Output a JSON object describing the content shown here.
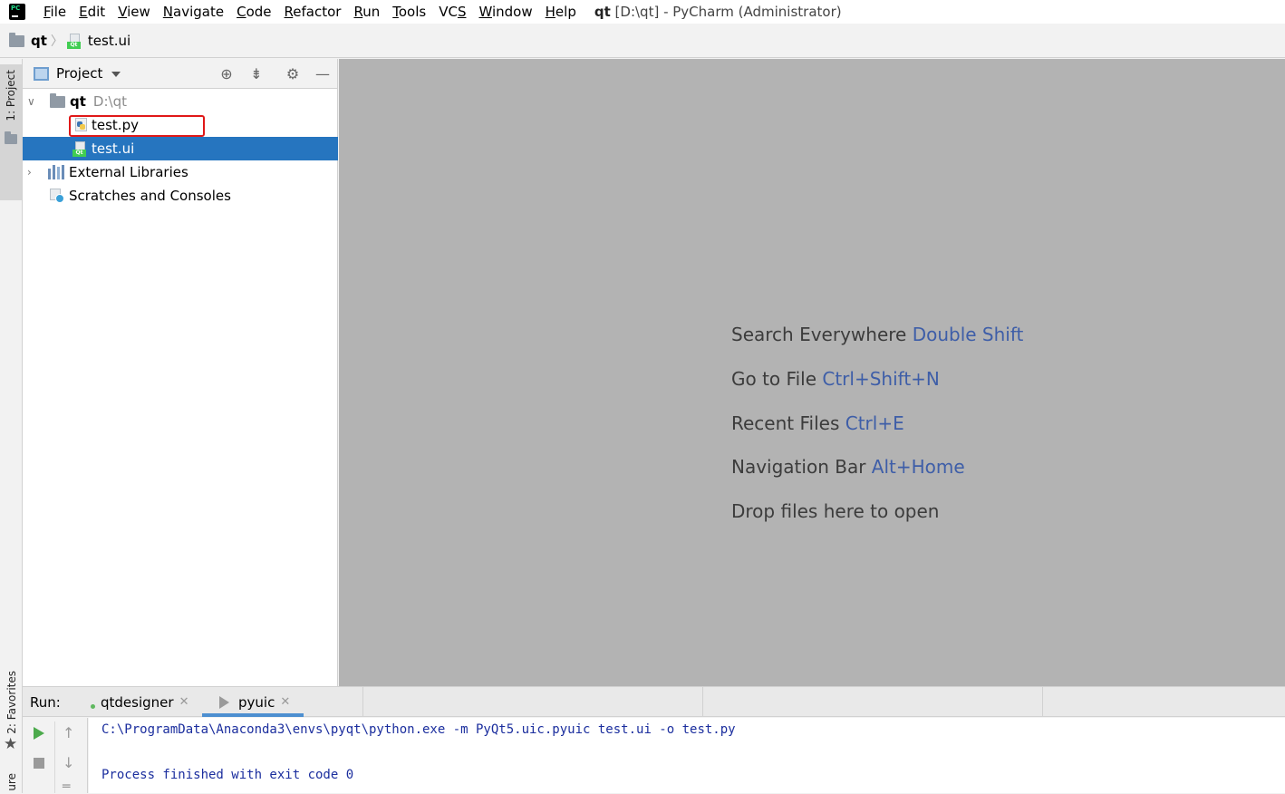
{
  "menubar": {
    "items": [
      {
        "label": "File",
        "mnemonic": "F",
        "rest": "ile"
      },
      {
        "label": "Edit",
        "mnemonic": "E",
        "rest": "dit"
      },
      {
        "label": "View",
        "mnemonic": "V",
        "rest": "iew"
      },
      {
        "label": "Navigate",
        "mnemonic": "N",
        "rest": "avigate"
      },
      {
        "label": "Code",
        "mnemonic": "C",
        "rest": "ode"
      },
      {
        "label": "Refactor",
        "mnemonic": "R",
        "rest": "efactor"
      },
      {
        "label": "Run",
        "mnemonic": "R",
        "rest": "un"
      },
      {
        "label": "Tools",
        "mnemonic": "T",
        "rest": "ools"
      },
      {
        "label": "VCS",
        "mnemonic": "S",
        "rest": "VC"
      },
      {
        "label": "Window",
        "mnemonic": "W",
        "rest": "indow"
      },
      {
        "label": "Help",
        "mnemonic": "H",
        "rest": "elp"
      }
    ],
    "title_project": "qt",
    "title_rest": "[D:\\qt] - PyCharm (Administrator)"
  },
  "breadcrumb": {
    "root": "qt",
    "file": "test.ui"
  },
  "left_stripe": {
    "project_label": "1: Project",
    "favorites_label": "2: Favorites",
    "bottom_label": "ure"
  },
  "project_panel": {
    "title": "Project",
    "tree": {
      "root_name": "qt",
      "root_path": "D:\\qt",
      "files": [
        "test.py",
        "test.ui"
      ],
      "external_libraries": "External Libraries",
      "scratches": "Scratches and Consoles"
    }
  },
  "editor": {
    "hints": [
      {
        "text": "Search Everywhere",
        "key": "Double Shift"
      },
      {
        "text": "Go to File",
        "key": "Ctrl+Shift+N"
      },
      {
        "text": "Recent Files",
        "key": "Ctrl+E"
      },
      {
        "text": "Navigation Bar",
        "key": "Alt+Home"
      },
      {
        "text": "Drop files here to open",
        "key": ""
      }
    ]
  },
  "run": {
    "label": "Run:",
    "tabs": [
      "qtdesigner",
      "pyuic"
    ],
    "console_lines": [
      "C:\\ProgramData\\Anaconda3\\envs\\pyqt\\python.exe -m PyQt5.uic.pyuic test.ui -o test.py",
      "",
      "Process finished with exit code 0"
    ]
  },
  "colors": {
    "selection": "#2675bf",
    "highlight_box": "#e01818",
    "console_text": "#1b2e9e",
    "shortcut": "#3e5ea8"
  }
}
